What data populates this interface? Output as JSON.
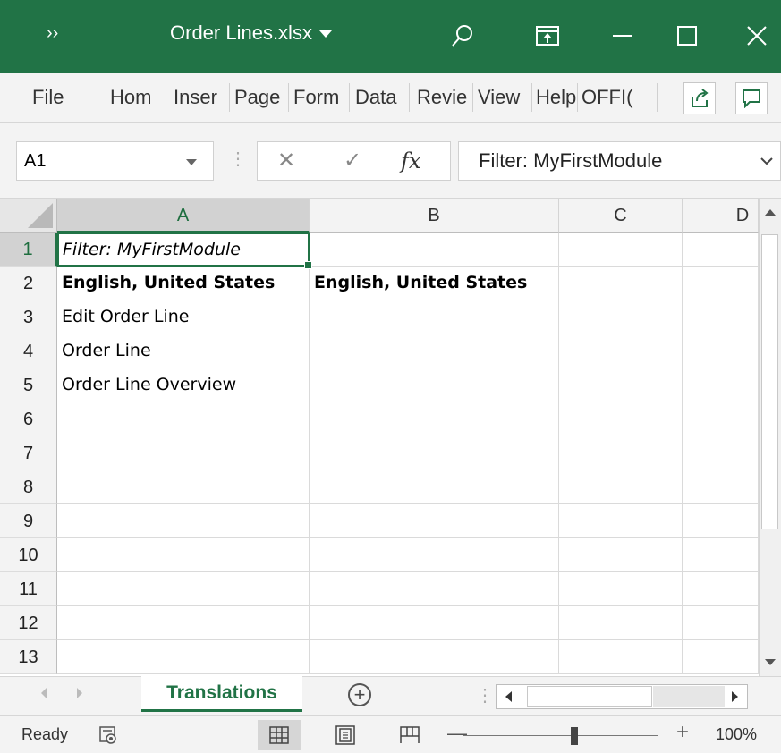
{
  "window": {
    "more_glyph": "››",
    "title": "Order Lines.xlsx"
  },
  "ribbon_tabs": [
    "File",
    "Hom",
    "Inser",
    "Page",
    "Form",
    "Data",
    "Revie",
    "View",
    "Help",
    "OFFI("
  ],
  "formula_bar": {
    "name_box": "A1",
    "cancel_glyph": "✕",
    "enter_glyph": "✓",
    "fx_glyph": "fx",
    "content": "Filter: MyFirstModule"
  },
  "columns": [
    "A",
    "B",
    "C",
    "D"
  ],
  "rows": [
    "1",
    "2",
    "3",
    "4",
    "5",
    "6",
    "7",
    "8",
    "9",
    "10",
    "11",
    "12",
    "13"
  ],
  "cells": {
    "A1": "Filter: MyFirstModule",
    "A2": "English, United States",
    "B2": "English, United States",
    "A3": "Edit Order Line",
    "A4": "Order Line",
    "A5": "Order Line Overview"
  },
  "sheet_tabs": {
    "active": "Translations",
    "add_glyph": "+"
  },
  "status_bar": {
    "status": "Ready",
    "zoom_minus": "—",
    "zoom_plus": "+",
    "zoom": "100%"
  },
  "colors": {
    "accent": "#217346",
    "chrome": "#f3f3f3"
  }
}
